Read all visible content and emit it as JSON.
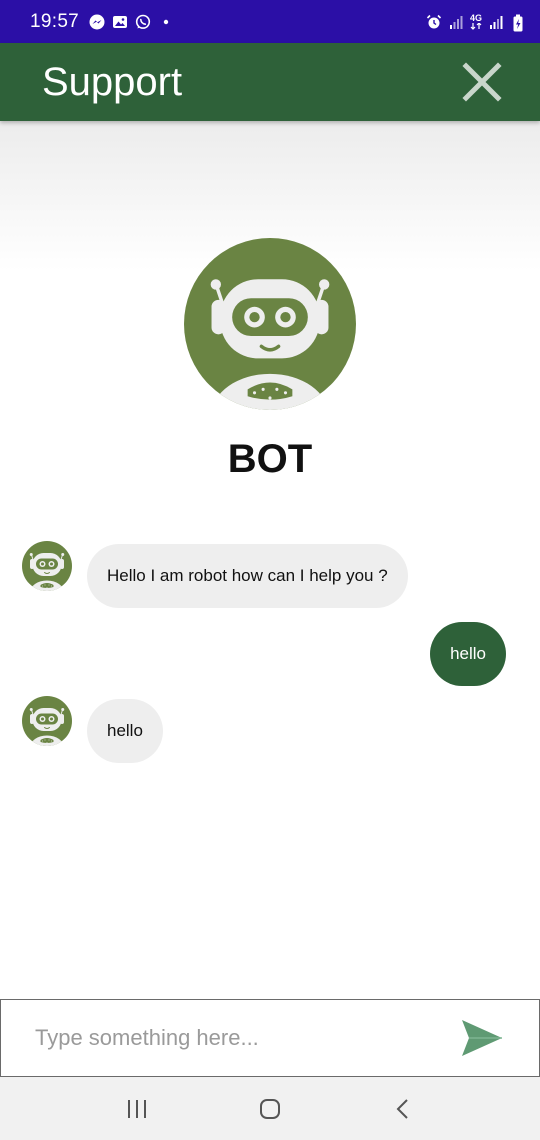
{
  "status_bar": {
    "time": "19:57",
    "left_icons": [
      "messenger-icon",
      "gallery-icon",
      "whatsapp-icon",
      "dot-icon"
    ],
    "right_icons": [
      "alarm-icon",
      "signal-icon",
      "network-4g-icon",
      "signal-icon",
      "battery-icon"
    ],
    "network_label": "4G"
  },
  "app_bar": {
    "title": "Support",
    "close_icon": "close-icon"
  },
  "bot": {
    "name": "BOT"
  },
  "messages": [
    {
      "sender": "bot",
      "text": "Hello I am robot how can I help you ?"
    },
    {
      "sender": "user",
      "text": "hello"
    },
    {
      "sender": "bot",
      "text": "hello"
    }
  ],
  "input": {
    "placeholder": "Type something here...",
    "value": ""
  },
  "nav": {
    "buttons": [
      "recents-icon",
      "home-icon",
      "back-icon"
    ]
  },
  "colors": {
    "status_bar": "#2b0fa6",
    "app_bar": "#2e6139",
    "avatar": "#6a8443",
    "user_bubble": "#2e6139",
    "bot_bubble": "#eeeeee",
    "send_icon": "#5f9a73"
  }
}
